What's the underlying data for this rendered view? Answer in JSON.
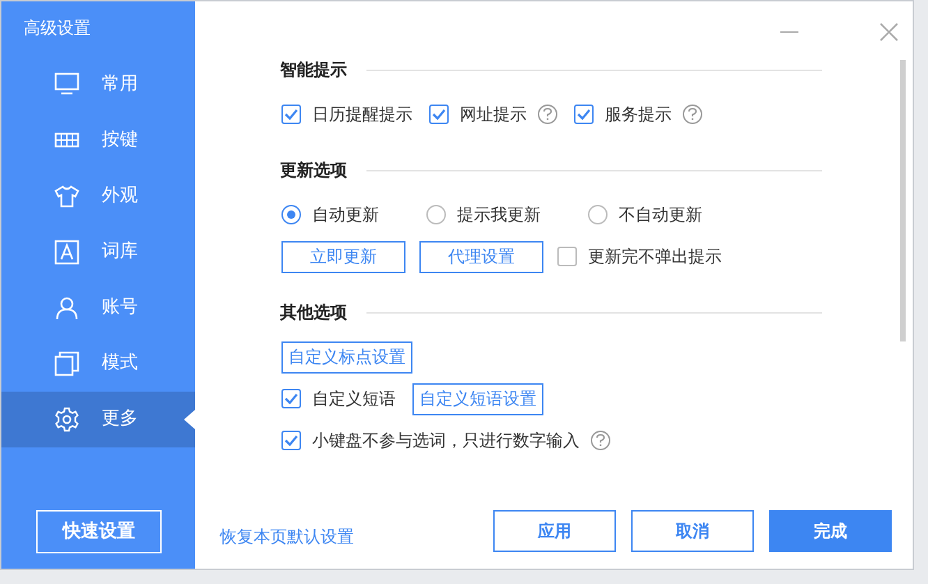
{
  "window": {
    "title": "高级设置"
  },
  "sidebar": {
    "items": [
      {
        "label": "常用",
        "selected": false
      },
      {
        "label": "按键",
        "selected": false
      },
      {
        "label": "外观",
        "selected": false
      },
      {
        "label": "词库",
        "selected": false
      },
      {
        "label": "账号",
        "selected": false
      },
      {
        "label": "模式",
        "selected": false
      },
      {
        "label": "更多",
        "selected": true
      }
    ],
    "quick_button": "快速设置"
  },
  "sections": [
    {
      "heading": "智能提示",
      "rows": [
        [
          {
            "kind": "checkbox",
            "label": "日历提醒提示",
            "checked": true,
            "help": false
          },
          {
            "kind": "checkbox",
            "label": "网址提示",
            "checked": true,
            "help": true
          },
          {
            "kind": "checkbox",
            "label": "服务提示",
            "checked": true,
            "help": true
          }
        ]
      ]
    },
    {
      "heading": "更新选项",
      "rows": [
        [
          {
            "kind": "radio",
            "label": "自动更新",
            "selected": true
          },
          {
            "kind": "radio",
            "label": "提示我更新",
            "selected": false
          },
          {
            "kind": "radio",
            "label": "不自动更新",
            "selected": false
          }
        ],
        [
          {
            "kind": "button",
            "label": "立即更新"
          },
          {
            "kind": "button",
            "label": "代理设置"
          },
          {
            "kind": "checkbox",
            "label": "更新完不弹出提示",
            "checked": false,
            "help": false
          }
        ]
      ]
    },
    {
      "heading": "其他选项",
      "rows": [
        [
          {
            "kind": "button",
            "label": "自定义标点设置"
          }
        ],
        [
          {
            "kind": "checkbox",
            "label": "自定义短语",
            "checked": true,
            "help": false
          },
          {
            "kind": "button",
            "label": "自定义短语设置"
          }
        ],
        [
          {
            "kind": "checkbox",
            "label": "小键盘不参与选词，只进行数字输入",
            "checked": true,
            "help": true
          }
        ]
      ]
    }
  ],
  "footer": {
    "restore_link": "恢复本页默认设置",
    "buttons": [
      {
        "label": "应用",
        "kind": "outline"
      },
      {
        "label": "取消",
        "kind": "outline"
      },
      {
        "label": "完成",
        "kind": "primary"
      }
    ]
  }
}
